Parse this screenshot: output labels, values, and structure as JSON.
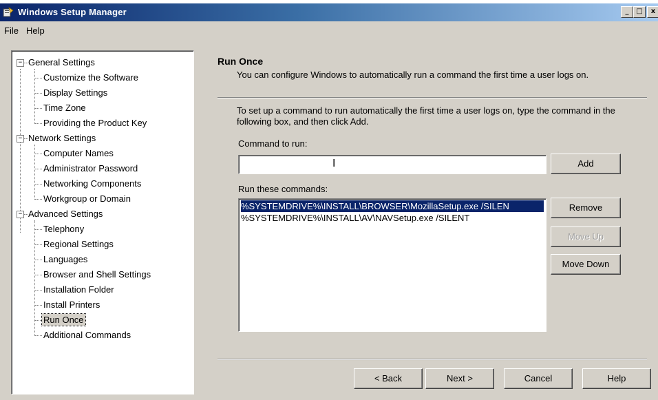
{
  "window": {
    "title": "Windows Setup Manager",
    "min_label": "_",
    "max_label": "□",
    "close_label": "x"
  },
  "menu": {
    "file": "File",
    "help": "Help"
  },
  "tree": {
    "groups": [
      {
        "label": "General Settings",
        "expander": "−",
        "items": [
          "Customize the Software",
          "Display Settings",
          "Time Zone",
          "Providing the Product Key"
        ]
      },
      {
        "label": "Network Settings",
        "expander": "−",
        "items": [
          "Computer Names",
          "Administrator Password",
          "Networking Components",
          "Workgroup or Domain"
        ]
      },
      {
        "label": "Advanced Settings",
        "expander": "−",
        "items": [
          "Telephony",
          "Regional Settings",
          "Languages",
          "Browser and Shell Settings",
          "Installation Folder",
          "Install Printers",
          "Run Once",
          "Additional Commands"
        ]
      }
    ],
    "selected_item": "Run Once"
  },
  "page": {
    "title": "Run Once",
    "description": "You can configure Windows to automatically run a command the first time a user logs on.",
    "instructions": "To set up a command to run automatically the first time a user logs on, type the command in the following box, and then click Add.",
    "command_label": "Command to run:",
    "command_value": "",
    "list_label": "Run these commands:",
    "commands": [
      "%SYSTEMDRIVE%\\INSTALL\\BROWSER\\MozillaSetup.exe /SILEN",
      "%SYSTEMDRIVE%\\INSTALL\\AV\\NAVSetup.exe /SILENT"
    ],
    "selected_command_index": 0,
    "buttons": {
      "add": "Add",
      "remove": "Remove",
      "move_up": "Move Up",
      "move_down": "Move Down"
    }
  },
  "footer": {
    "back": "< Back",
    "next": "Next >",
    "cancel": "Cancel",
    "help": "Help"
  }
}
